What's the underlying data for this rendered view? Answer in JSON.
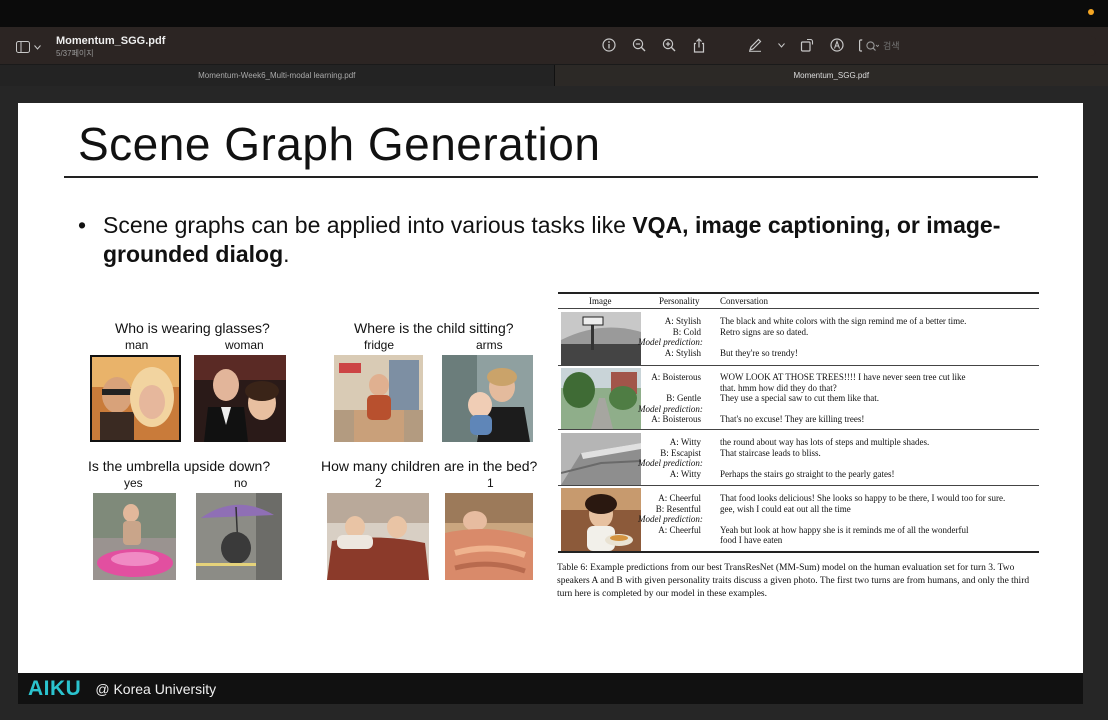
{
  "window": {
    "doc_title": "Momentum_SGG.pdf",
    "page_info": "5/37페이지",
    "search_placeholder": "검색"
  },
  "icons": [
    "sidebar-icon",
    "chevron-down-icon",
    "info-icon",
    "zoom-out-icon",
    "zoom-in-icon",
    "share-icon",
    "pen-icon",
    "chevron-down-icon",
    "rotate-icon",
    "markup-icon",
    "redact-icon",
    "search-icon"
  ],
  "tabs": [
    {
      "label": "Momentum-Week6_Multi-modal learning.pdf",
      "active": false
    },
    {
      "label": "Momentum_SGG.pdf",
      "active": true
    }
  ],
  "slide": {
    "title": "Scene Graph Generation",
    "bullet_lead": "Scene graphs can be applied into various tasks like ",
    "bullet_bold": "VQA, image captioning, or image-grounded dialog",
    "bullet_tail": ".",
    "vqa": [
      {
        "question": "Who is wearing glasses?",
        "answers": [
          "man",
          "woman"
        ]
      },
      {
        "question": "Where is the child sitting?",
        "answers": [
          "fridge",
          "arms"
        ]
      },
      {
        "question": "Is the umbrella upside down?",
        "answers": [
          "yes",
          "no"
        ]
      },
      {
        "question": "How many children are in the bed?",
        "answers": [
          "2",
          "1"
        ]
      }
    ],
    "table": {
      "headers": [
        "Image",
        "Personality",
        "Conversation"
      ],
      "rows": [
        {
          "personality": [
            "A: Stylish",
            "B: Cold",
            "Model prediction:",
            "A: Stylish"
          ],
          "conversation": [
            "The black and white colors with the sign remind me of a better time.",
            "Retro signs are so dated.",
            "",
            "But they're so trendy!"
          ]
        },
        {
          "personality": [
            "A: Boisterous",
            "",
            "B: Gentle",
            "Model prediction:",
            "A: Boisterous"
          ],
          "conversation": [
            "WOW LOOK AT THOSE TREES!!!! I have never seen tree cut like",
            "that. hmm how did they do that?",
            "They use a special saw to cut them like that.",
            "",
            "That's no excuse! They are killing trees!"
          ]
        },
        {
          "personality": [
            "A: Witty",
            "B: Escapist",
            "Model prediction:",
            "A: Witty"
          ],
          "conversation": [
            "the round about way has lots of steps and multiple shades.",
            "That staircase leads to bliss.",
            "",
            "Perhaps the stairs go straight to the pearly gates!"
          ]
        },
        {
          "personality": [
            "A: Cheerful",
            "B: Resentful",
            "Model prediction:",
            "A: Cheerful"
          ],
          "conversation": [
            "That food looks delicious! She looks so happy to be there, I would too for sure.",
            "gee, wish I could eat out all the time",
            "",
            "Yeah but look at how happy she is it reminds me of all the wonderful",
            "food I have eaten"
          ]
        }
      ],
      "caption": "Table 6: Example predictions from our best TransResNet (MM-Sum) model on the human evaluation set for turn 3. Two speakers A and B with given personality traits discuss a given photo. The first two turns are from humans, and only the third turn here is completed by our model in these examples."
    }
  },
  "footer": {
    "logo": "AIKU",
    "org": "@ Korea University"
  },
  "colors": {
    "logo_accent": "#2bc3ce",
    "titlebar": "#2c2523",
    "slide_bg": "#ffffff"
  }
}
